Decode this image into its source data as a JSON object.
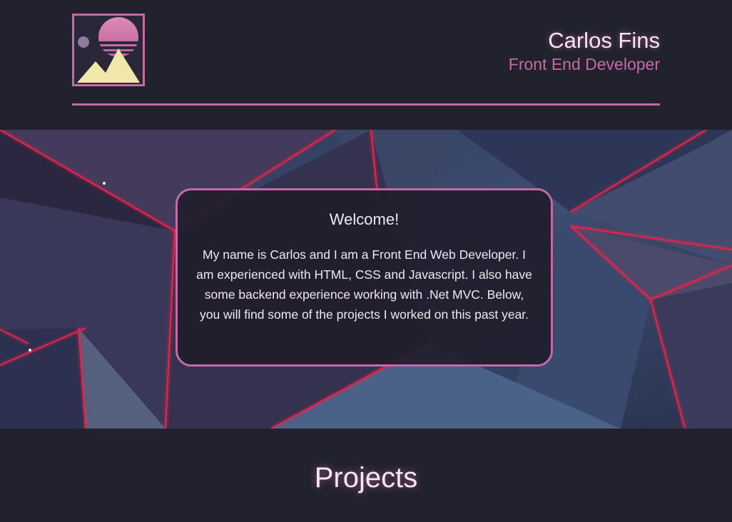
{
  "header": {
    "name": "Carlos Fins",
    "role": "Front End Developer"
  },
  "welcome": {
    "title": "Welcome!",
    "text": "My name is Carlos and I am a Front End Web Developer. I am experienced with HTML, CSS and Javascript. I also have some backend experience working with .Net MVC. Below, you will find some of the projects I worked on this past year."
  },
  "projects": {
    "title": "Projects"
  },
  "colors": {
    "background": "#22222e",
    "accent": "#c56aa6",
    "text": "#f1e8ee",
    "neon": "#e8244a"
  }
}
